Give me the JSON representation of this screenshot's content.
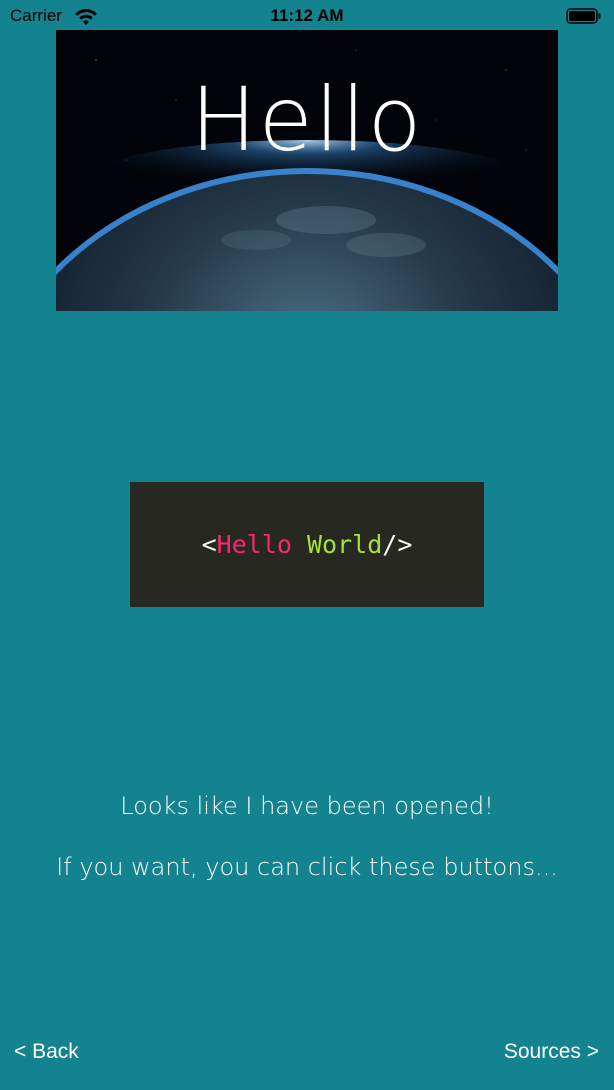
{
  "status_bar": {
    "carrier": "Carrier",
    "time": "11:12 AM",
    "wifi_icon": "wifi-icon",
    "battery_icon": "battery-icon"
  },
  "hero": {
    "title": "Hello"
  },
  "code_snippet": {
    "open": "<",
    "word1": "Hello",
    "space": " ",
    "word2": "World",
    "close": "/>",
    "colors": {
      "background": "#272822",
      "tag": "#f8f8f2",
      "word1": "#f92672",
      "word2": "#a6e22e"
    }
  },
  "messages": {
    "line1": "Looks like I have been opened!",
    "line2": "If you want, you can click these buttons..."
  },
  "nav": {
    "back_label": "< Back",
    "sources_label": "Sources >"
  },
  "colors": {
    "background": "#13838f",
    "text": "#ffffff"
  }
}
